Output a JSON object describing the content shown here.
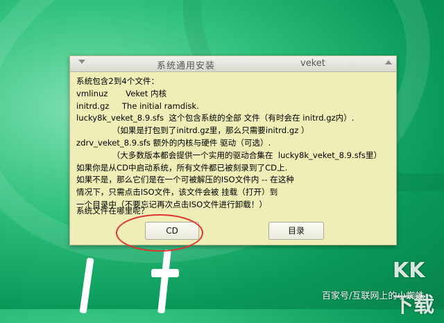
{
  "window": {
    "title": "系统通用安装",
    "app_name": "veket"
  },
  "body_lines": [
    "系统包含2到4个文件：",
    "vmlinuz       Veket 内核",
    "initrd.gz     The initial ramdisk.",
    "lucky8k_veket_8.9.sfs  这个包含系统的全部 文件（有时会在 initrd.gz内）.",
    "              （如果是打包到了initrd.gz里，那么只需要initrd.gz ）",
    "zdrv_veket_8.9.sfs 额外的内核与硬件 驱动（可选）.",
    "              （大多数版本都会提供一个实用的驱动合集在  lucky8k_veket_8.9.sfs里）",
    "如果你是从CD中启动系统，所有文件都已被刻录到了CD上.",
    "如果不是，那么它们是在一个可被解压的ISO文件内 -- 在这种",
    "情况下，只需点击ISO文件，该文件会被 挂载（打开）到",
    "一个目录中（不要忘记再次点击ISO文件进行卸载！）"
  ],
  "question": "系统文件在哪里呢？",
  "buttons": {
    "cd": "CD",
    "directory": "目录"
  },
  "watermark": "百家号/互联网上的小蜘蛛",
  "badge": "KK下载",
  "colors": {
    "desktop_green": "#0a9a5a",
    "dialog_bg": "#eeeeb6",
    "highlight_red": "#e0322e"
  }
}
